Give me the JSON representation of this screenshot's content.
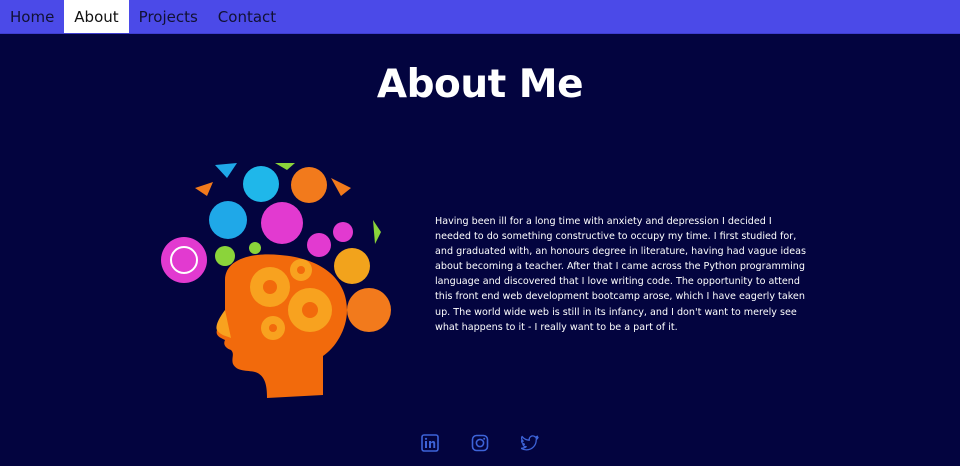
{
  "nav": {
    "items": [
      {
        "label": "Home",
        "active": false
      },
      {
        "label": "About",
        "active": true
      },
      {
        "label": "Projects",
        "active": false
      },
      {
        "label": "Contact",
        "active": false
      }
    ]
  },
  "main": {
    "title": "About Me",
    "paragraph": "Having been ill for a long time with anxiety and depression I decided I needed to do something constructive to occupy my time. I first studied for, and graduated with, an honours degree in literature, having had vague ideas about becoming a teacher. After that I came across the Python programming language and discovered that I love writing code. The opportunity to attend this front end web development bootcamp arose, which I have eagerly taken up. The world wide web is still in its infancy, and I don't want to merely see what happens to it - I really want to be a part of it.",
    "illustration_icon": "head-with-gears-and-science-icons"
  },
  "colors": {
    "background": "#03043f",
    "navbar": "#4b4ae8",
    "social_icon": "#3d63d8",
    "head_orange": "#f26a0c"
  },
  "social": {
    "icons": [
      "linkedin-icon",
      "instagram-icon",
      "twitter-icon"
    ]
  }
}
